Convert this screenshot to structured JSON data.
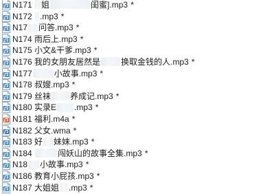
{
  "files": [
    {
      "icon": "audio-file-icon",
      "parts": [
        "N171 ",
        "",
        "姐",
        "",
        "闺蜜].mp3"
      ],
      "mark": "*",
      "blurs": [
        0,
        8,
        0,
        58,
        0
      ]
    },
    {
      "icon": "audio-file-icon",
      "parts": [
        "N172 ",
        "",
        ".mp3"
      ],
      "mark": "*",
      "blurs": [
        0,
        6,
        0
      ]
    },
    {
      "icon": "audio-file-icon",
      "parts": [
        "N17",
        "",
        "问答.mp3"
      ],
      "mark": "*",
      "blurs": [
        0,
        14,
        0
      ]
    },
    {
      "icon": "audio-file-icon",
      "parts": [
        "N174 雨后上.mp3"
      ],
      "mark": "*",
      "blurs": [
        0
      ]
    },
    {
      "icon": "audio-file-icon",
      "parts": [
        "N175 小文&干爹.mp3"
      ],
      "mark": "*",
      "blurs": [
        0
      ]
    },
    {
      "icon": "audio-file-icon",
      "parts": [
        "N176 我的女朋友居然是",
        "",
        "换取金钱的人.mp3"
      ],
      "mark": "*",
      "blurs": [
        0,
        28,
        0
      ]
    },
    {
      "icon": "audio-file-icon",
      "parts": [
        "N177",
        "",
        "小故事.mp3"
      ],
      "mark": "*",
      "blurs": [
        0,
        30,
        0
      ]
    },
    {
      "icon": "audio-file-icon",
      "parts": [
        "N178 叔嫂.mp3"
      ],
      "mark": "*",
      "blurs": [
        0
      ]
    },
    {
      "icon": "audio-file-icon",
      "parts": [
        "N179 丝袜",
        "",
        "养成记.mp3"
      ],
      "mark": "*",
      "blurs": [
        0,
        26,
        0
      ]
    },
    {
      "icon": "audio-file-icon",
      "parts": [
        "N180 实录E",
        "",
        ".mp3"
      ],
      "mark": "*",
      "blurs": [
        0,
        24,
        0
      ]
    },
    {
      "icon": "audio-file-icon-m4a",
      "parts": [
        "N181 福利.m4a"
      ],
      "mark": "*",
      "blurs": [
        0
      ]
    },
    {
      "icon": "audio-file-icon-wma",
      "parts": [
        "N182 父女.wma"
      ],
      "mark": "*",
      "blurs": [
        0
      ]
    },
    {
      "icon": "audio-file-icon",
      "parts": [
        "N183 好",
        "",
        "妹妹.mp3"
      ],
      "mark": "*",
      "blurs": [
        0,
        14,
        0
      ]
    },
    {
      "icon": "audio-file-icon",
      "parts": [
        "N184 ",
        "",
        "闯妖山的故事全集.mp3"
      ],
      "mark": "*",
      "blurs": [
        0,
        32,
        0
      ]
    },
    {
      "icon": "audio-file-icon",
      "parts": [
        "N18",
        "",
        "小故事.mp3"
      ],
      "mark": "*",
      "blurs": [
        0,
        16,
        0
      ]
    },
    {
      "icon": "audio-file-icon",
      "parts": [
        "N186 教育小屁孩.mp3"
      ],
      "mark": "*",
      "blurs": [
        0
      ]
    },
    {
      "icon": "audio-file-icon",
      "parts": [
        "N187 大姐姐",
        "",
        ".mp3"
      ],
      "mark": "*",
      "blurs": [
        0,
        12,
        0
      ]
    }
  ]
}
